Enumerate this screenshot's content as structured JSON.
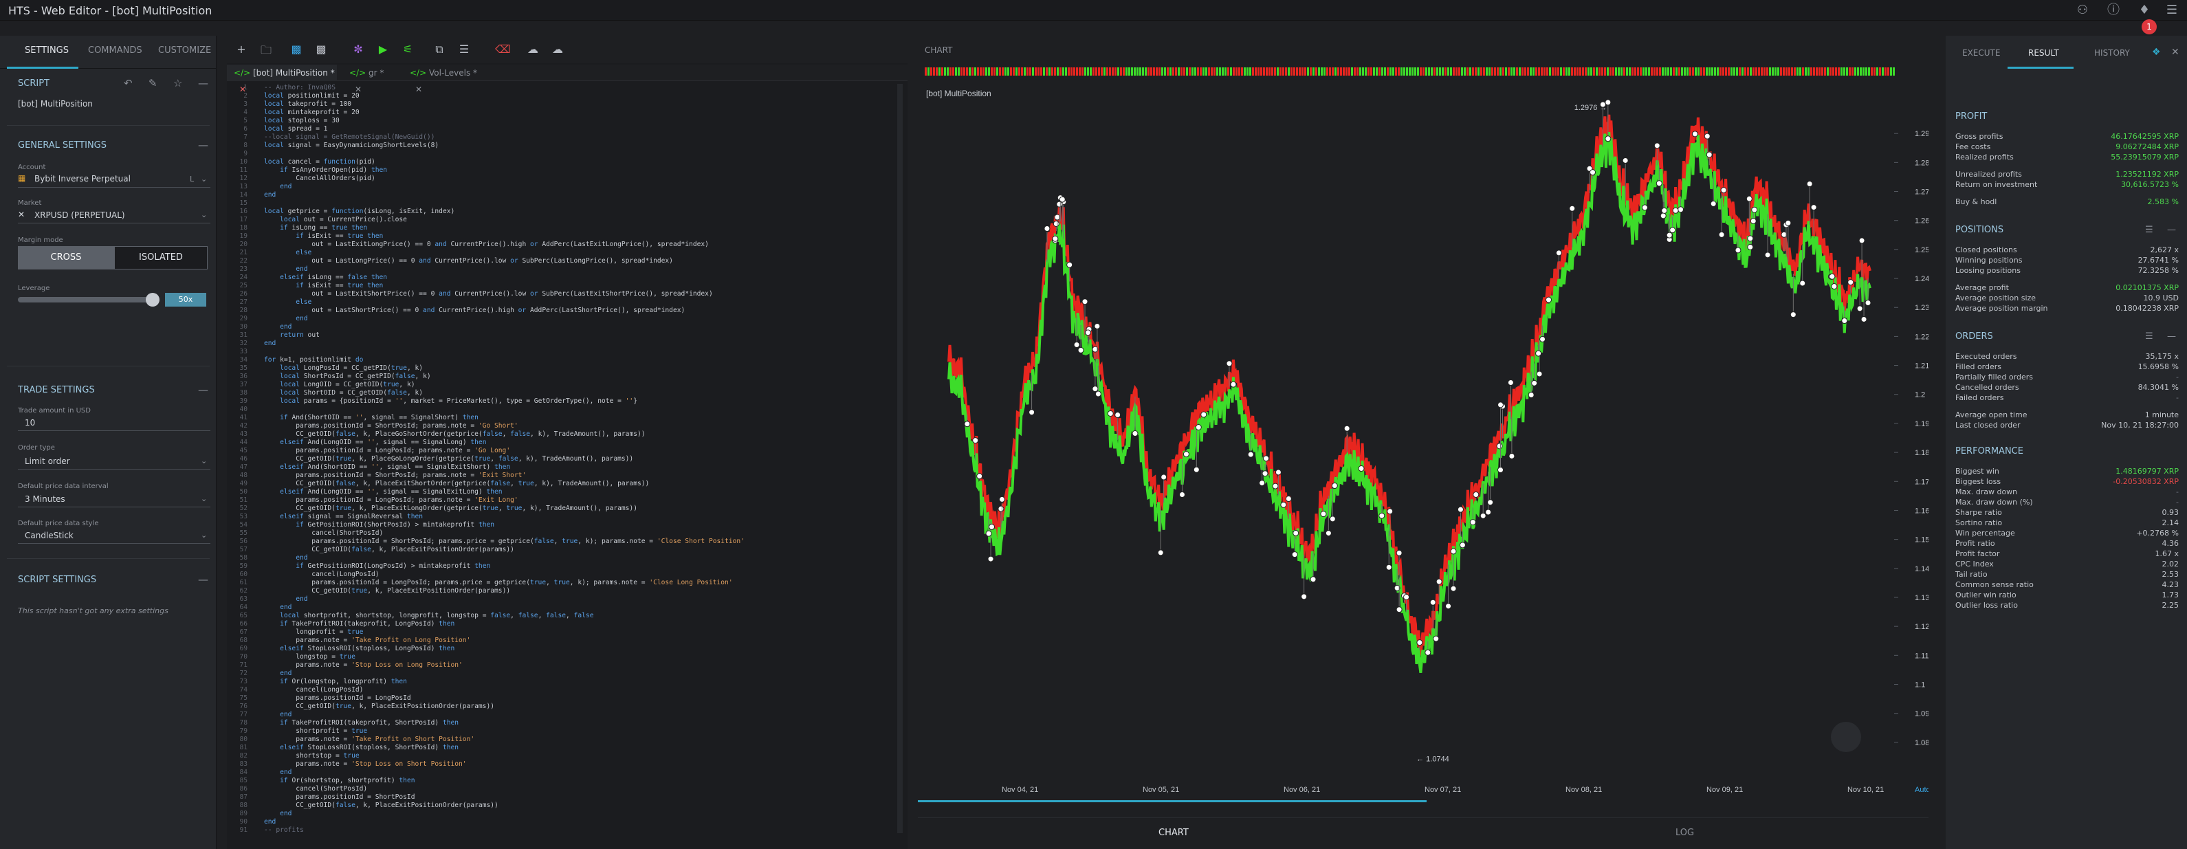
{
  "window": {
    "title": "HTS - Web Editor - [bot] MultiPosition",
    "notification_count": "1"
  },
  "left": {
    "tabs": [
      "SETTINGS",
      "COMMANDS",
      "CUSTOMIZE"
    ],
    "script_section": "SCRIPT",
    "script_name": "[bot] MultiPosition",
    "general_section": "GENERAL SETTINGS",
    "account_label": "Account",
    "account_value": "Bybit Inverse Perpetual",
    "account_suffix": "L",
    "market_label": "Market",
    "market_value": "XRPUSD (PERPETUAL)",
    "margin_label": "Margin mode",
    "cross": "CROSS",
    "isolated": "ISOLATED",
    "leverage_label": "Leverage",
    "leverage_value": "50x",
    "trade_section": "TRADE SETTINGS",
    "trade_amount_label": "Trade amount in USD",
    "trade_amount_value": "10",
    "order_type_label": "Order type",
    "order_type_value": "Limit order",
    "interval_label": "Default price data interval",
    "interval_value": "3 Minutes",
    "style_label": "Default price data style",
    "style_value": "CandleStick",
    "script_settings_section": "SCRIPT SETTINGS",
    "script_settings_note": "This script hasn't got any extra settings"
  },
  "editor": {
    "tabs": [
      {
        "label": "[bot] MultiPosition *"
      },
      {
        "label": "gr *"
      },
      {
        "label": "Vol-Levels *"
      }
    ],
    "lines": [
      "-- Author: InvaQ0S",
      "local positionlimit = 20",
      "local takeprofit = 100",
      "local mintakeprofit = 20",
      "local stoploss = 30",
      "local spread = 1",
      "--local signal = GetRemoteSignal(NewGuid())",
      "local signal = EasyDynamicLongShortLevels(8)",
      "",
      "local cancel = function(pid)",
      "    if IsAnyOrderOpen(pid) then",
      "        CancelAllOrders(pid)",
      "    end",
      "end",
      "",
      "local getprice = function(isLong, isExit, index)",
      "    local out = CurrentPrice().close",
      "    if isLong == true then",
      "        if isExit == true then",
      "            out = LastExitLongPrice() == 0 and CurrentPrice().high or AddPerc(LastExitLongPrice(), spread*index)",
      "        else",
      "            out = LastLongPrice() == 0 and CurrentPrice().low or SubPerc(LastLongPrice(), spread*index)",
      "        end",
      "    elseif isLong == false then",
      "        if isExit == true then",
      "            out = LastExitShortPrice() == 0 and CurrentPrice().low or SubPerc(LastExitShortPrice(), spread*index)",
      "        else",
      "            out = LastShortPrice() == 0 and CurrentPrice().high or AddPerc(LastShortPrice(), spread*index)",
      "        end",
      "    end",
      "    return out",
      "end",
      "",
      "for k=1, positionlimit do",
      "    local LongPosId = CC_getPID(true, k)",
      "    local ShortPosId = CC_getPID(false, k)",
      "    local LongOID = CC_getOID(true, k)",
      "    local ShortOID = CC_getOID(false, k)",
      "    local params = {positionId = '', market = PriceMarket(), type = GetOrderType(), note = ''}",
      "",
      "    if And(ShortOID == '', signal == SignalShort) then",
      "        params.positionId = ShortPosId; params.note = 'Go Short'",
      "        CC_getOID(false, k, PlaceGoShortOrder(getprice(false, false, k), TradeAmount(), params))",
      "    elseif And(LongOID == '', signal == SignalLong) then",
      "        params.positionId = LongPosId; params.note = 'Go Long'",
      "        CC_getOID(true, k, PlaceGoLongOrder(getprice(true, false, k), TradeAmount(), params))",
      "    elseif And(ShortOID == '', signal == SignalExitShort) then",
      "        params.positionId = ShortPosId; params.note = 'Exit Short'",
      "        CC_getOID(false, k, PlaceExitShortOrder(getprice(false, true, k), TradeAmount(), params))",
      "    elseif And(LongOID == '', signal == SignalExitLong) then",
      "        params.positionId = LongPosId; params.note = 'Exit Long'",
      "        CC_getOID(true, k, PlaceExitLongOrder(getprice(true, true, k), TradeAmount(), params))",
      "    elseif signal == SignalReversal then",
      "        if GetPositionROI(ShortPosId) > mintakeprofit then",
      "            cancel(ShortPosId)",
      "            params.positionId = ShortPosId; params.price = getprice(false, true, k); params.note = 'Close Short Position'",
      "            CC_getOID(false, k, PlaceExitPositionOrder(params))",
      "        end",
      "        if GetPositionROI(LongPosId) > mintakeprofit then",
      "            cancel(LongPosId)",
      "            params.positionId = LongPosId; params.price = getprice(true, true, k); params.note = 'Close Long Position'",
      "            CC_getOID(true, k, PlaceExitPositionOrder(params))",
      "        end",
      "    end",
      "    local shortprofit, shortstop, longprofit, longstop = false, false, false, false",
      "    if TakeProfitROI(takeprofit, LongPosId) then",
      "        longprofit = true",
      "        params.note = 'Take Profit on Long Position'",
      "    elseif StopLossROI(stoploss, LongPosId) then",
      "        longstop = true",
      "        params.note = 'Stop Loss on Long Position'",
      "    end",
      "    if Or(longstop, longprofit) then",
      "        cancel(LongPosId)",
      "        params.positionId = LongPosId",
      "        CC_getOID(true, k, PlaceExitPositionOrder(params))",
      "    end",
      "    if TakeProfitROI(takeprofit, ShortPosId) then",
      "        shortprofit = true",
      "        params.note = 'Take Profit on Short Position'",
      "    elseif StopLossROI(stoploss, ShortPosId) then",
      "        shortstop = true",
      "        params.note = 'Stop Loss on Short Position'",
      "    end",
      "    if Or(shortstop, shortprofit) then",
      "        cancel(ShortPosId)",
      "        params.positionId = ShortPosId",
      "        CC_getOID(false, k, PlaceExitPositionOrder(params))",
      "    end",
      "end",
      "-- profits"
    ]
  },
  "chart": {
    "header": "CHART",
    "instrument": "[bot] MultiPosition",
    "bottom_tabs": [
      "CHART",
      "LOG"
    ],
    "auto_label": "Auto",
    "colors": {
      "up": "#3ddc2a",
      "down": "#e8261f",
      "bg": "#1e1f22"
    }
  },
  "chart_data": {
    "type": "line",
    "x": [
      "Nov 04, 21",
      "Nov 05, 21",
      "Nov 06, 21",
      "Nov 07, 21",
      "Nov 08, 21",
      "Nov 09, 21",
      "Nov 10, 21"
    ],
    "ylim": [
      1.07,
      1.3
    ],
    "yticks": [
      "1.29",
      "1.28",
      "1.27",
      "1.26",
      "1.25",
      "1.24",
      "1.23",
      "1.22",
      "1.21",
      "1.2",
      "1.19",
      "1.18",
      "1.17",
      "1.16",
      "1.15",
      "1.14",
      "1.13",
      "1.12",
      "1.11",
      "1.1",
      "1.09",
      "1.08"
    ],
    "high_marker": "1.2976",
    "low_marker": "1.0744",
    "series": [
      {
        "name": "",
        "values": [
          1.21,
          1.205,
          1.18,
          1.16,
          1.15,
          1.17,
          1.2,
          1.21,
          1.25,
          1.26,
          1.23,
          1.22,
          1.21,
          1.19,
          1.18,
          1.2,
          1.17,
          1.16,
          1.17,
          1.18,
          1.19,
          1.195,
          1.2,
          1.205,
          1.19,
          1.18,
          1.17,
          1.16,
          1.15,
          1.14,
          1.16,
          1.17,
          1.18,
          1.175,
          1.17,
          1.16,
          1.14,
          1.12,
          1.11,
          1.12,
          1.14,
          1.15,
          1.16,
          1.17,
          1.18,
          1.19,
          1.2,
          1.21,
          1.23,
          1.24,
          1.25,
          1.26,
          1.28,
          1.29,
          1.27,
          1.26,
          1.27,
          1.28,
          1.26,
          1.27,
          1.29,
          1.28,
          1.27,
          1.26,
          1.25,
          1.27,
          1.26,
          1.25,
          1.24,
          1.26,
          1.25,
          1.24,
          1.23,
          1.24,
          1.24
        ]
      }
    ]
  },
  "right": {
    "tabs": [
      "EXECUTE",
      "RESULT",
      "HISTORY"
    ],
    "profit_section": "PROFIT",
    "profit": [
      {
        "k": "Gross profits",
        "v": "46.17642595 XRP",
        "c": "g"
      },
      {
        "k": "Fee costs",
        "v": "9.06272484 XRP",
        "c": "g"
      },
      {
        "k": "Realized profits",
        "v": "55.23915079 XRP",
        "c": "g"
      },
      {
        "k": "Unrealized profits",
        "v": "1.23521192 XRP",
        "c": "g"
      },
      {
        "k": "Return on investment",
        "v": "30,616.5723 %",
        "c": "g"
      },
      {
        "k": "Buy & hodl",
        "v": "2.583 %",
        "c": "g"
      }
    ],
    "positions_section": "POSITIONS",
    "positions": [
      {
        "k": "Closed positions",
        "v": "2,627 x",
        "c": ""
      },
      {
        "k": "Winning positions",
        "v": "27.6741 %",
        "c": ""
      },
      {
        "k": "Loosing positions",
        "v": "72.3258 %",
        "c": ""
      },
      {
        "k": "Average profit",
        "v": "0.02101375 XRP",
        "c": "g"
      },
      {
        "k": "Average position size",
        "v": "10.9 USD",
        "c": ""
      },
      {
        "k": "Average position margin",
        "v": "0.18042238 XRP",
        "c": ""
      }
    ],
    "orders_section": "ORDERS",
    "orders": [
      {
        "k": "Executed orders",
        "v": "35,175 x",
        "c": ""
      },
      {
        "k": "Filled orders",
        "v": "15.6958 %",
        "c": ""
      },
      {
        "k": "Partially filled orders",
        "v": "-",
        "c": "m"
      },
      {
        "k": "Cancelled orders",
        "v": "84.3041 %",
        "c": ""
      },
      {
        "k": "Failed orders",
        "v": "-",
        "c": "m"
      },
      {
        "k": "Average open time",
        "v": "1 minute",
        "c": ""
      },
      {
        "k": "Last closed order",
        "v": "Nov 10, 21  18:27:00",
        "c": ""
      }
    ],
    "performance_section": "PERFORMANCE",
    "performance": [
      {
        "k": "Biggest win",
        "v": "1.48169797 XRP",
        "c": "g"
      },
      {
        "k": "Biggest loss",
        "v": "-0.20530832 XRP",
        "c": "r"
      },
      {
        "k": "Max. draw down",
        "v": "-",
        "c": "m"
      },
      {
        "k": "Max. draw down (%)",
        "v": "-",
        "c": "m"
      },
      {
        "k": "Sharpe ratio",
        "v": "0.93",
        "c": ""
      },
      {
        "k": "Sortino ratio",
        "v": "2.14",
        "c": ""
      },
      {
        "k": "Win percentage",
        "v": "+0.2768 %",
        "c": ""
      },
      {
        "k": "Profit ratio",
        "v": "4.36",
        "c": ""
      },
      {
        "k": "Profit factor",
        "v": "1.67 x",
        "c": ""
      },
      {
        "k": "CPC Index",
        "v": "2.02",
        "c": ""
      },
      {
        "k": "Tail ratio",
        "v": "2.53",
        "c": ""
      },
      {
        "k": "Common sense ratio",
        "v": "4.23",
        "c": ""
      },
      {
        "k": "Outlier win ratio",
        "v": "1.73",
        "c": ""
      },
      {
        "k": "Outlier loss ratio",
        "v": "2.25",
        "c": ""
      }
    ]
  }
}
